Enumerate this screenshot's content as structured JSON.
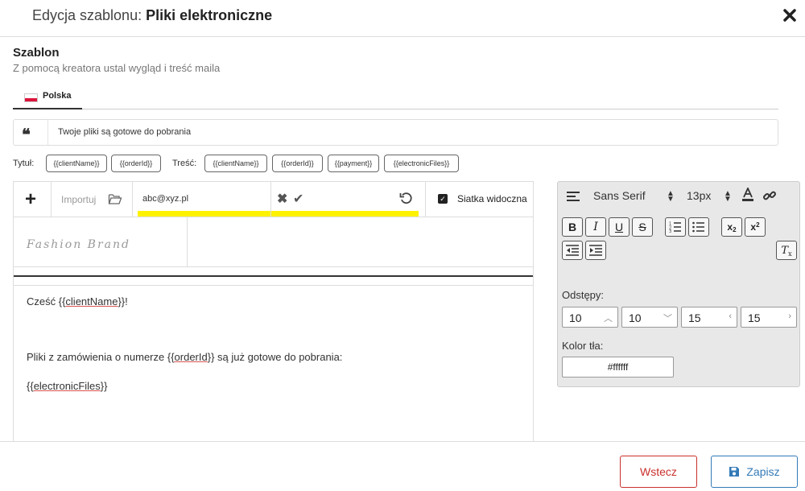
{
  "header": {
    "title_prefix": "Edycja szablonu:",
    "title_name": "Pliki elektroniczne"
  },
  "section": {
    "title": "Szablon",
    "subtitle": "Z pomocą kreatora ustal wygląd i treść maila"
  },
  "tabs": [
    {
      "label": "Polska",
      "flag": "poland-flag"
    }
  ],
  "subject": {
    "value": "Twoje pliki są gotowe do pobrania"
  },
  "placeholders": {
    "title_label": "Tytuł:",
    "title_tags": [
      "{{clientName}}",
      "{{orderId}}"
    ],
    "content_label": "Treść:",
    "content_tags": [
      "{{clientName}}",
      "{{orderId}}",
      "{{payment}}",
      "{{electronicFiles}}"
    ]
  },
  "editor_toolbar": {
    "import_label": "Importuj",
    "email_value": "abc@xyz.pl",
    "grid_label": "Siatka widoczna",
    "grid_checked": true
  },
  "logo_text": "Fashion Brand",
  "email_body": {
    "greeting_prefix": "Cześć {{",
    "greeting_var": "clientName",
    "greeting_suffix": "}}!",
    "line2_prefix": "Pliki z zamówienia o numerze {{",
    "line2_var": "orderId",
    "line2_suffix": "}} są już gotowe do pobrania:",
    "line3_prefix": "{{",
    "line3_var": "electronicFiles",
    "line3_suffix": "}}"
  },
  "format_panel": {
    "font": "Sans Serif",
    "size": "13px",
    "spacing_label": "Odstępy:",
    "spacing_values": [
      "10",
      "10",
      "15",
      "15"
    ],
    "bg_label": "Kolor tła:",
    "bg_value": "#ffffff"
  },
  "footer": {
    "back_label": "Wstecz",
    "save_label": "Zapisz"
  },
  "colors": {
    "danger": "#c9302c",
    "primary": "#337ab7",
    "highlight": "#fff200"
  }
}
